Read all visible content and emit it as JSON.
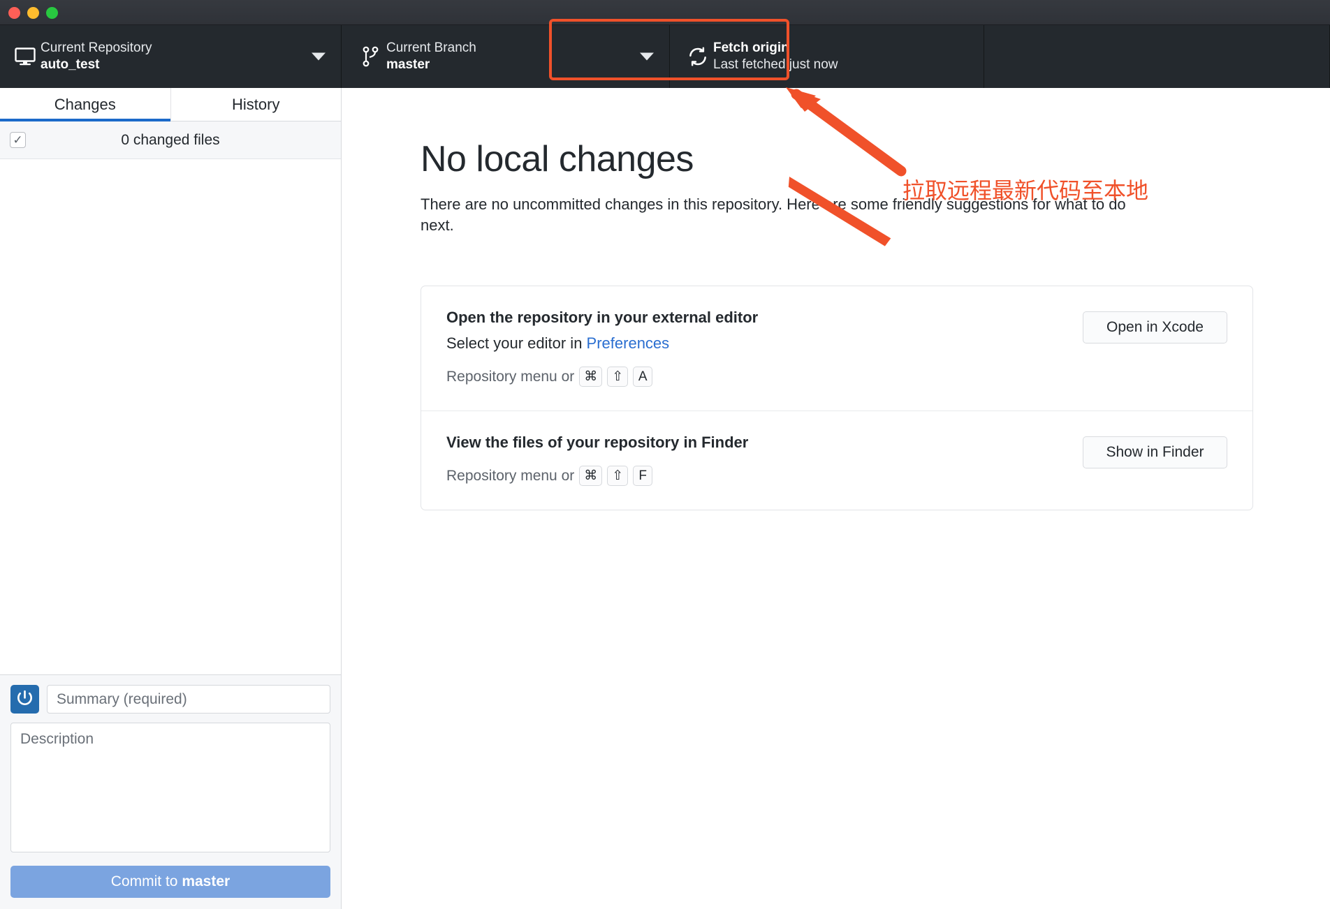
{
  "window": {
    "traffic_lights": [
      "close",
      "minimize",
      "zoom"
    ],
    "colors": {
      "close": "#ff5f57",
      "minimize": "#febc2e",
      "zoom": "#28c840",
      "accent": "#1b6ac9",
      "annotation": "#f0512a"
    }
  },
  "toolbar": {
    "repository": {
      "icon": "desktop-icon",
      "label": "Current Repository",
      "value": "auto_test"
    },
    "branch": {
      "icon": "branch-icon",
      "label": "Current Branch",
      "value": "master"
    },
    "fetch": {
      "icon": "sync-icon",
      "label": "Fetch origin",
      "value": "Last fetched just now"
    }
  },
  "sidebar": {
    "tabs": [
      {
        "label": "Changes",
        "active": true
      },
      {
        "label": "History",
        "active": false
      }
    ],
    "changed_files": {
      "checkbox": "checked",
      "label": "0 changed files"
    },
    "commit": {
      "avatar_icon": "gravatar-power-icon",
      "summary_placeholder": "Summary (required)",
      "summary_value": "",
      "description_placeholder": "Description",
      "description_value": "",
      "button_prefix": "Commit to ",
      "button_branch": "master"
    }
  },
  "main": {
    "title": "No local changes",
    "subtitle": "There are no uncommitted changes in this repository. Here are some friendly suggestions for what to do next.",
    "suggestions": [
      {
        "title": "Open the repository in your external editor",
        "description_prefix": "Select your editor in ",
        "description_link": "Preferences",
        "menu_hint": "Repository menu or",
        "keys": [
          "⌘",
          "⇧",
          "A"
        ],
        "action": "Open in Xcode"
      },
      {
        "title": "View the files of your repository in Finder",
        "description_prefix": "",
        "description_link": "",
        "menu_hint": "Repository menu or",
        "keys": [
          "⌘",
          "⇧",
          "F"
        ],
        "action": "Show in Finder"
      }
    ]
  },
  "annotations": {
    "arrow_target": "fetch-origin-button",
    "note": "拉取远程最新代码至本地"
  }
}
